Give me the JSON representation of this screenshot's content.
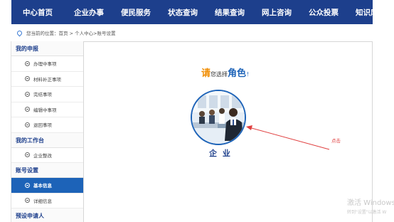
{
  "nav": {
    "items": [
      "中心首页",
      "企业办事",
      "便民服务",
      "状态查询",
      "结果查询",
      "网上咨询",
      "公众投票",
      "知识库"
    ]
  },
  "breadcrumb": {
    "text": "您当前的位置：首页 > 个人中心>账号设置"
  },
  "sidebar": {
    "sections": [
      {
        "title": "我的申报",
        "items": [
          "办理中事项",
          "材料补正事项",
          "完结事项",
          "编辑中事项",
          "退回事项"
        ]
      },
      {
        "title": "我的工作台",
        "items": [
          "企业整改"
        ]
      },
      {
        "title": "账号设置",
        "items": [
          "基本信息",
          "详细信息"
        ]
      },
      {
        "title": "预设申请人",
        "items": []
      }
    ],
    "active_item": "基本信息"
  },
  "main": {
    "heading": {
      "part1": "请",
      "part2": "您选择",
      "part3": "角色",
      "part4": "!"
    },
    "role_label": "企 业",
    "click_hint": "点击"
  },
  "watermark": {
    "line1": "激活 Windows",
    "line2": "转到\"设置\"以激活 W"
  },
  "colors": {
    "nav_bg": "#1d3f8c",
    "accent_blue": "#1d63b8",
    "accent_orange": "#f08c00",
    "hint_red": "#e04040"
  },
  "icons": {
    "location": "location-pin-icon",
    "side_item": "circle-minus-icon"
  }
}
